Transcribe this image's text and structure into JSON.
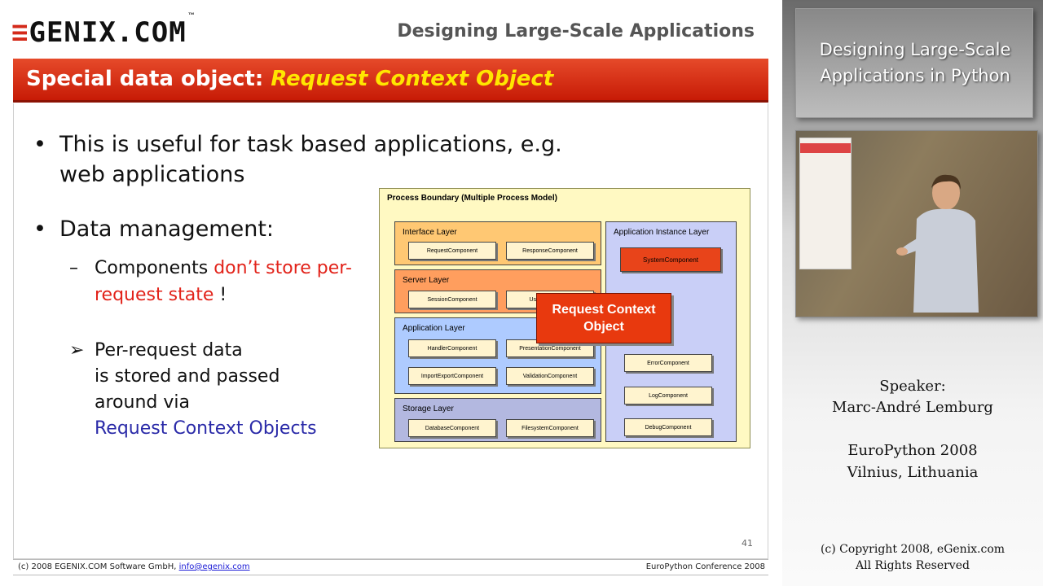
{
  "slide": {
    "logo": {
      "mark": "≡",
      "text": "GENIX.COM",
      "tm": "™"
    },
    "header_title": "Designing Large-Scale Applications",
    "title": {
      "prefix": "Special data object:",
      "highlight": "Request Context Object"
    },
    "bullets": [
      {
        "marker": "•",
        "text": "This is useful for task based applications, e.g. web applications"
      },
      {
        "marker": "•",
        "text": "Data management:"
      }
    ],
    "sub_bullet": {
      "marker": "–",
      "text_prefix": "Components",
      "text_red": "don’t store per-request state",
      "text_suffix": " !"
    },
    "arrow_bullet": {
      "marker": "➢",
      "line1": "Per-request data",
      "line2": "is stored and passed",
      "line3": "around via",
      "link_text": "Request Context Objects"
    },
    "page_number": "41"
  },
  "diagram": {
    "title": "Process Boundary (Multiple Process Model)",
    "layers": [
      {
        "label": "Interface Layer",
        "components": [
          "RequestComponent",
          "ResponseComponent"
        ]
      },
      {
        "label": "Server Layer",
        "components": [
          "SessionComponent",
          "UserComponent"
        ]
      },
      {
        "label": "Application Layer",
        "components": [
          "HandlerComponent",
          "PresentationComponent",
          "ImportExportComponent",
          "ValidationComponent"
        ]
      },
      {
        "label": "Storage Layer",
        "components": [
          "DatabaseComponent",
          "FilesystemComponent"
        ]
      },
      {
        "label": "Application Instance Layer",
        "components": [
          "SystemComponent",
          "ErrorComponent",
          "LogComponent",
          "DebugComponent"
        ]
      }
    ],
    "overlay_label": "Request Context Object"
  },
  "footer": {
    "left": "(c) 2008 EGENIX.COM Software GmbH,",
    "email": "info@egenix.com",
    "right": "EuroPython Conference 2008"
  },
  "panel": {
    "title": "Designing Large-Scale Applications in Python",
    "speaker_label": "Speaker:",
    "speaker_name": "Marc-André Lemburg",
    "event": "EuroPython 2008",
    "location": "Vilnius, Lithuania",
    "copyright": "(c) Copyright 2008, eGenix.com",
    "rights": "All Rights Reserved"
  },
  "colors": {
    "title_bar": "#d42a1a",
    "highlight": "#ffe600",
    "accent_red": "#e2231a",
    "link_blue": "#2a2aa8"
  }
}
